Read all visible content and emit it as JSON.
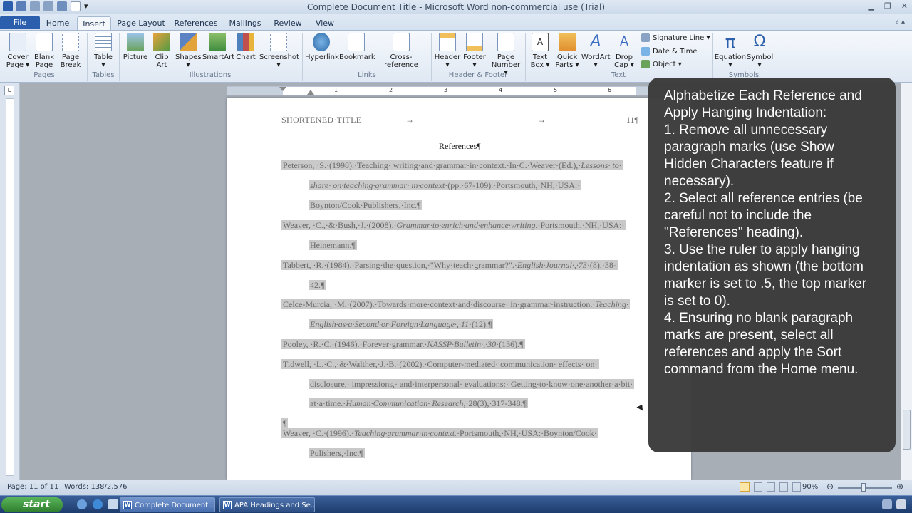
{
  "window": {
    "title": "Complete Document Title - Microsoft Word non-commercial use (Trial)"
  },
  "ribbon_tabs": [
    "File",
    "Home",
    "Insert",
    "Page Layout",
    "References",
    "Mailings",
    "Review",
    "View"
  ],
  "ribbon": {
    "pages": {
      "label": "Pages",
      "cover": "Cover Page ▾",
      "blank": "Blank Page",
      "break": "Page Break"
    },
    "tables": {
      "label": "Tables",
      "table": "Table ▾"
    },
    "illustrations": {
      "label": "Illustrations",
      "picture": "Picture",
      "clipart": "Clip Art",
      "shapes": "Shapes ▾",
      "smartart": "SmartArt",
      "chart": "Chart",
      "screenshot": "Screenshot ▾"
    },
    "links": {
      "label": "Links",
      "hyperlink": "Hyperlink",
      "bookmark": "Bookmark",
      "crossref": "Cross-reference"
    },
    "header_footer": {
      "label": "Header & Footer",
      "header": "Header ▾",
      "footer": "Footer ▾",
      "pagenum": "Page Number ▾"
    },
    "text": {
      "label": "Text",
      "textbox": "Text Box ▾",
      "quickparts": "Quick Parts ▾",
      "wordart": "WordArt ▾",
      "dropcap": "Drop Cap ▾",
      "sigline": "Signature Line ▾",
      "datetime": "Date & Time",
      "object": "Object ▾"
    },
    "symbols": {
      "label": "Symbols",
      "equation": "Equation ▾",
      "symbol": "Symbol ▾"
    }
  },
  "ruler": {
    "marks": [
      "1",
      "2",
      "3",
      "4",
      "5",
      "6"
    ]
  },
  "document": {
    "header_title": "SHORTENED·TITLE",
    "arrow": "→",
    "page_number": "11¶",
    "heading": "References¶",
    "lines": [
      {
        "segments": [
          {
            "t": "Peterson, ·S.·(1998).·Teaching· writing·and·grammar·in·context.·In·C.·Weaver·(Ed.),·"
          },
          {
            "t": "Lessons· to·",
            "i": true
          }
        ]
      },
      {
        "segments": [
          {
            "t": "share· on·teaching·grammar· in·context",
            "i": true
          },
          {
            "t": "·(pp.·67-109).·Portsmouth,·NH,·USA:·"
          }
        ]
      },
      {
        "segments": [
          {
            "t": "Boynton/Cook·Publishers,·Inc.¶"
          }
        ]
      },
      {
        "segments": [
          {
            "t": "Weaver, ·C.,·&·Bush,·J.·(2008).·"
          },
          {
            "t": "Grammar·to·enrich·and·enhance·writing.",
            "i": true
          },
          {
            "t": "·Portsmouth,·NH,·USA:·"
          }
        ]
      },
      {
        "segments": [
          {
            "t": "Heinemann.¶"
          }
        ]
      },
      {
        "segments": [
          {
            "t": "Tabbert, ·R.·(1984).·Parsing·the·question,·\"Why·teach·grammar?\".·"
          },
          {
            "t": "English·Journal·,·73",
            "i": true
          },
          {
            "t": "·(8),·38-"
          }
        ]
      },
      {
        "segments": [
          {
            "t": "42.¶"
          }
        ]
      },
      {
        "segments": [
          {
            "t": "Celce-Murcia, ·M.·(2007).·Towards·more·context·and·discourse· in·grammar·instruction.·"
          },
          {
            "t": "Teaching·",
            "i": true
          }
        ]
      },
      {
        "segments": [
          {
            "t": "English·as·a·Second·or·Foreign·Language·,·11",
            "i": true
          },
          {
            "t": "·(12).¶"
          }
        ]
      },
      {
        "segments": [
          {
            "t": "Pooley, ·R.·C.·(1946).·Forever·grammar.·"
          },
          {
            "t": "NASSP·Bulletin·,·30",
            "i": true
          },
          {
            "t": "·(136).¶"
          }
        ]
      },
      {
        "segments": [
          {
            "t": "Tidwell, ·L.·C.,·&·Walther,·J.·B.·(2002).·Computer-mediated· communication· effects· on·"
          }
        ]
      },
      {
        "segments": [
          {
            "t": "disclosure,· impressions,· and·interpersonal· evaluations:· Getting·to·know·one·another·a·bit·"
          }
        ]
      },
      {
        "segments": [
          {
            "t": "at·a·time.·"
          },
          {
            "t": "Human·Communication· Research,",
            "i": true
          },
          {
            "t": "·28(3),·317-348.¶"
          }
        ]
      },
      {
        "segments": [
          {
            "t": "¶"
          }
        ]
      },
      {
        "segments": [
          {
            "t": "Weaver, ·C.·(1996).·"
          },
          {
            "t": "Teaching·grammar·in·context.",
            "i": true
          },
          {
            "t": "·Portsmouth,·NH,·USA:·Boynton/Cook·"
          }
        ]
      },
      {
        "segments": [
          {
            "t": "Pulishers,·Inc.¶"
          }
        ]
      }
    ]
  },
  "overlay": {
    "title": "Alphabetize Each Reference and Apply Hanging Indentation:",
    "steps": [
      "1. Remove all unnecessary paragraph marks (use Show Hidden Characters feature if necessary).",
      "2. Select all reference entries (be careful not to include the \"References\" heading).",
      "3. Use the ruler to apply hanging indentation as shown (the bottom marker is set to .5, the top marker is set to 0).",
      "4. Ensuring no blank paragraph marks are present, select all references and apply the Sort command from the Home menu."
    ]
  },
  "status": {
    "page": "Page: 11 of 11",
    "words": "Words: 138/2,576",
    "zoom": "90%"
  },
  "taskbar": {
    "start": "start",
    "items": [
      "Complete Document ...",
      "APA Headings and Se..."
    ]
  },
  "colors": {
    "accent": "#2b5fad",
    "overlay_bg": "#3b3b3b",
    "highlight": "#c9c9c9"
  }
}
